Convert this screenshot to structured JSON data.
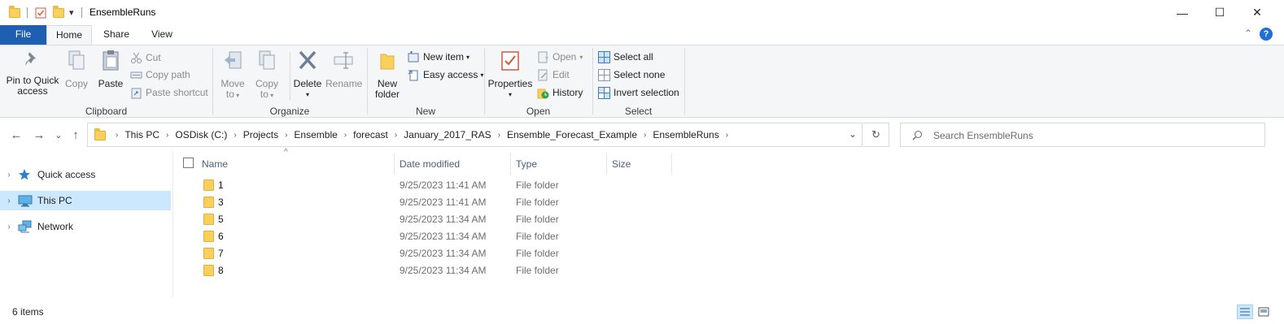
{
  "window": {
    "title": "EnsembleRuns",
    "minimize_glyph": "—",
    "maximize_glyph": "☐",
    "close_glyph": "✕"
  },
  "quick_access_toolbar": {
    "dropdown_glyph": "▾"
  },
  "ribbon": {
    "tabs": [
      {
        "label": "File"
      },
      {
        "label": "Home"
      },
      {
        "label": "Share"
      },
      {
        "label": "View"
      }
    ],
    "collapse_glyph": "⌃",
    "help_glyph": "?",
    "groups": {
      "clipboard": {
        "label": "Clipboard",
        "pin_line1": "Pin to Quick",
        "pin_line2": "access",
        "copy": "Copy",
        "paste": "Paste",
        "cut": "Cut",
        "copy_path": "Copy path",
        "paste_shortcut": "Paste shortcut"
      },
      "organize": {
        "label": "Organize",
        "move_to_line1": "Move",
        "move_to_line2": "to",
        "copy_to_line1": "Copy",
        "copy_to_line2": "to",
        "delete": "Delete",
        "rename": "Rename"
      },
      "new": {
        "label": "New",
        "new_folder_line1": "New",
        "new_folder_line2": "folder",
        "new_item": "New item",
        "easy_access": "Easy access"
      },
      "open": {
        "label": "Open",
        "properties": "Properties",
        "open": "Open",
        "edit": "Edit",
        "history": "History"
      },
      "select": {
        "label": "Select",
        "select_all": "Select all",
        "select_none": "Select none",
        "invert_selection": "Invert selection"
      }
    }
  },
  "navigation": {
    "back_glyph": "←",
    "forward_glyph": "→",
    "recent_glyph": "⌄",
    "up_glyph": "↑",
    "breadcrumbs": [
      "This PC",
      "OSDisk (C:)",
      "Projects",
      "Ensemble",
      "forecast",
      "January_2017_RAS",
      "Ensemble_Forecast_Example",
      "EnsembleRuns"
    ],
    "crumb_separator": "›",
    "address_dropdown_glyph": "⌄",
    "refresh_glyph": "↻",
    "search_placeholder": "Search EnsembleRuns"
  },
  "nav_pane": {
    "expand_glyph": "›",
    "items": [
      {
        "label": "Quick access"
      },
      {
        "label": "This PC"
      },
      {
        "label": "Network"
      }
    ]
  },
  "file_list": {
    "sort_glyph": "^",
    "columns": [
      {
        "label": "Name"
      },
      {
        "label": "Date modified"
      },
      {
        "label": "Type"
      },
      {
        "label": "Size"
      }
    ],
    "rows": [
      {
        "name": "1",
        "date": "9/25/2023 11:41 AM",
        "type": "File folder"
      },
      {
        "name": "3",
        "date": "9/25/2023 11:41 AM",
        "type": "File folder"
      },
      {
        "name": "5",
        "date": "9/25/2023 11:34 AM",
        "type": "File folder"
      },
      {
        "name": "6",
        "date": "9/25/2023 11:34 AM",
        "type": "File folder"
      },
      {
        "name": "7",
        "date": "9/25/2023 11:34 AM",
        "type": "File folder"
      },
      {
        "name": "8",
        "date": "9/25/2023 11:34 AM",
        "type": "File folder"
      }
    ]
  },
  "status_bar": {
    "item_count": "6 items"
  },
  "colors": {
    "file_tab": "#1e5fb4",
    "selected_nav": "#cce8ff",
    "folder_yellow": "#f8d05b",
    "help_blue": "#1e6fd9"
  }
}
